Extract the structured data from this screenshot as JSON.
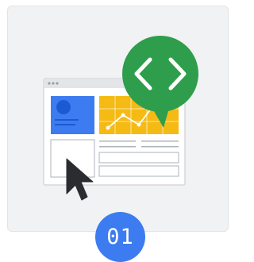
{
  "illustration": {
    "icons": {
      "code": "code-brackets-icon",
      "cursor": "mouse-pointer-icon",
      "profile": "profile-card-icon",
      "chart": "line-chart-icon"
    },
    "colors": {
      "card_bg": "#f1f2f3",
      "browser_frame": "#d5d7da",
      "window_bg": "#ffffff",
      "profile_blue": "#3d7cf0",
      "avatar_blue": "#1a5bd4",
      "chart_yellow": "#f5ba13",
      "bubble_green": "#2e9e4c",
      "cursor_dark": "#2b2c30"
    }
  },
  "step_badge": {
    "number": "01",
    "color": "#3d7cf0"
  }
}
